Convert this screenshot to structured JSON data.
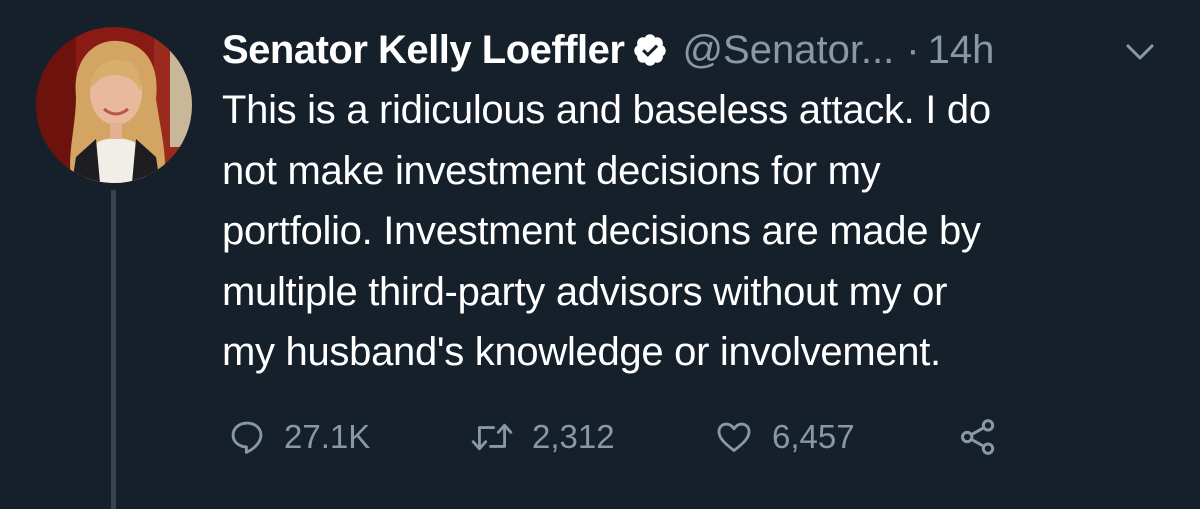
{
  "tweet": {
    "author_name": "Senator Kelly Loeffler",
    "handle": "@Senator...",
    "separator": "·",
    "time": "14h",
    "text": "This is a ridiculous and baseless attack. I do\nnot make investment decisions for my\nportfolio. Investment decisions are made by\nmultiple third-party advisors without my or\nmy husband's knowledge or involvement.",
    "verified": true
  },
  "actions": {
    "reply_count": "27.1K",
    "retweet_count": "2,312",
    "like_count": "6,457"
  },
  "icons": {
    "reply": "reply-icon",
    "retweet": "retweet-icon",
    "like": "heart-icon",
    "share": "share-icon",
    "verified": "verified-badge-icon",
    "menu": "chevron-down-icon"
  },
  "colors": {
    "background": "#15202b",
    "primary_text": "#ffffff",
    "secondary_text": "#8899a6",
    "thread_line": "#38444d"
  }
}
